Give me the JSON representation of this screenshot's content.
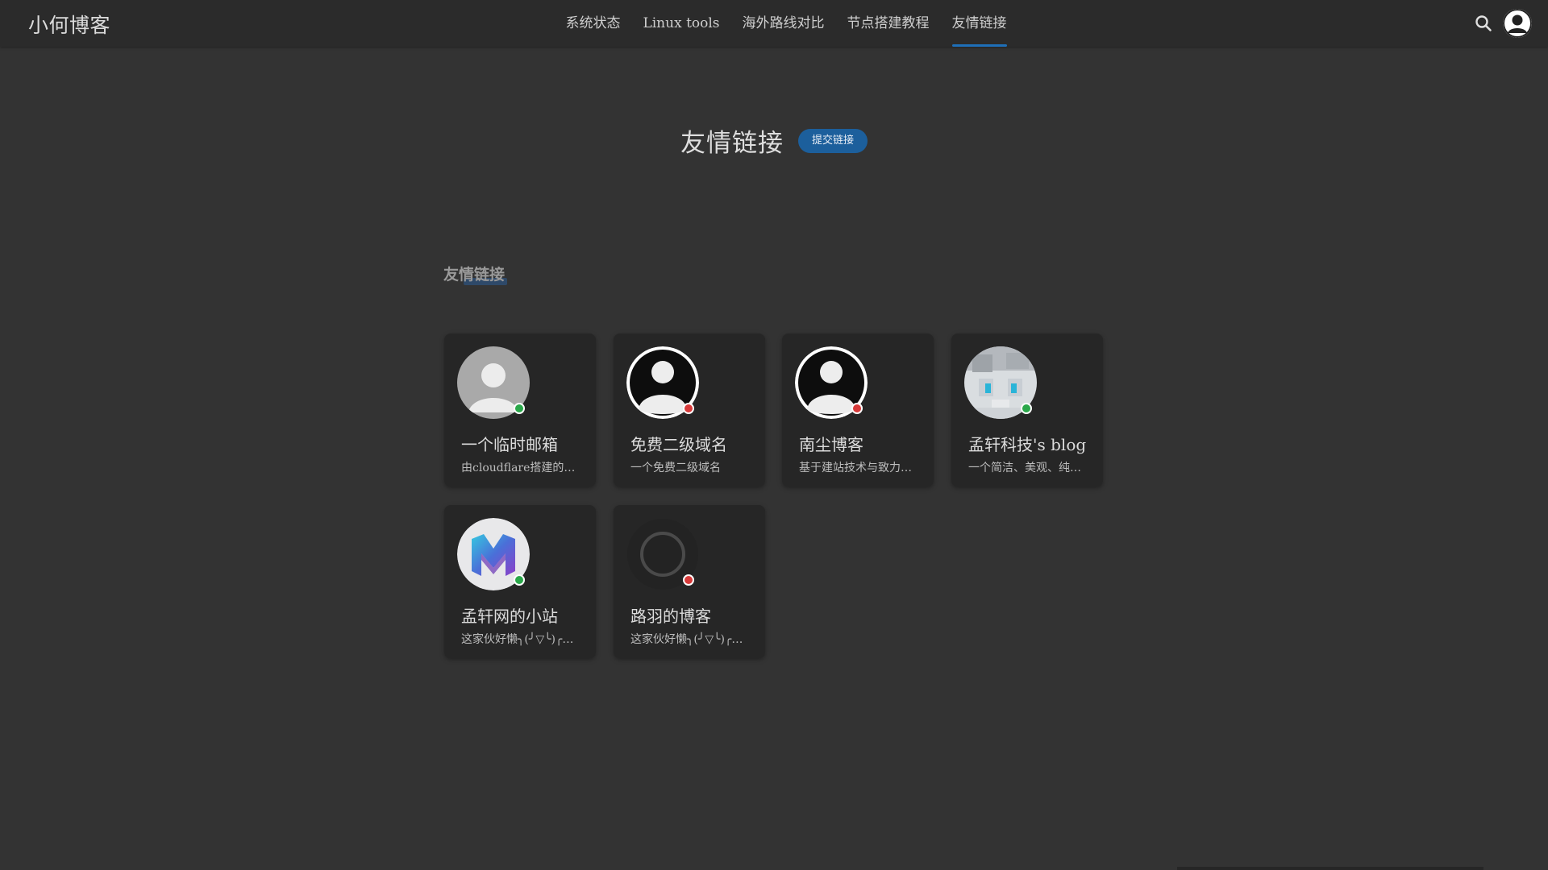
{
  "site": {
    "brand": "小何博客"
  },
  "nav": {
    "items": [
      {
        "label": "系统状态"
      },
      {
        "label": "Linux tools"
      },
      {
        "label": "海外路线对比"
      },
      {
        "label": "节点搭建教程"
      },
      {
        "label": "友情链接"
      }
    ],
    "active_index": 4
  },
  "header_icons": {
    "search": "search-icon",
    "account": "user-avatar-icon"
  },
  "page": {
    "title": "友情链接",
    "submit_label": "提交链接"
  },
  "section": {
    "label": "友情链接"
  },
  "links": [
    {
      "name": "一个临时邮箱",
      "desc": "由cloudflare搭建的…",
      "status": "online",
      "avatar": "gray-person-avatar"
    },
    {
      "name": "免费二级域名",
      "desc": "一个免费二级域名",
      "status": "offline",
      "avatar": "black-person-avatar"
    },
    {
      "name": "南尘博客",
      "desc": "基于建站技术与致力…",
      "status": "offline",
      "avatar": "black-person-avatar"
    },
    {
      "name": "孟轩科技's blog",
      "desc": "一个简洁、美观、纯…",
      "status": "online",
      "avatar": "blurred-anime-avatar"
    },
    {
      "name": "孟轩网的小站",
      "desc": "这家伙好懒╮(╯▽╰)╭…",
      "status": "online",
      "avatar": "m-logo-avatar"
    },
    {
      "name": "路羽的博客",
      "desc": "这家伙好懒╮(╯▽╰)╭…",
      "status": "offline",
      "avatar": "loading-ring-avatar"
    }
  ],
  "colors": {
    "background": "#333333",
    "header": "#2b2b2b",
    "card": "#262626",
    "accent": "#1e6fb8",
    "online": "#2aa84a",
    "offline": "#d83a3a"
  }
}
